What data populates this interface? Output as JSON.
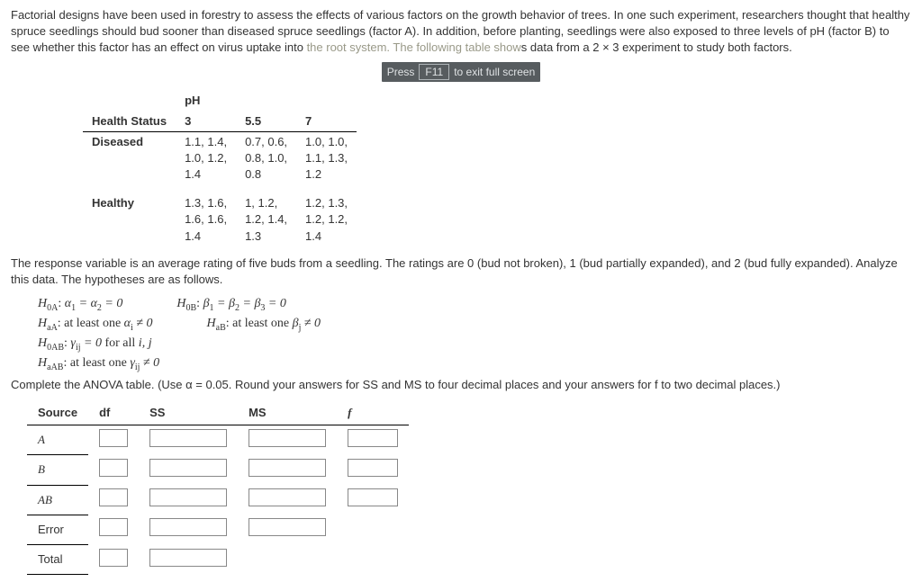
{
  "intro": {
    "p1a": "Factorial designs have been used in forestry to assess the effects of various factors on the growth behavior of trees. In one such experiment, researchers thought that healthy spruce seedlings should bud sooner than diseased spruce seedlings (factor A). In addition, before planting, seedlings were also exposed to three levels of pH (factor B) to see whether this factor has an effect on virus uptake into ",
    "dim1": "the root system. The following table show",
    "p1b": "s data from a 2 × 3 experiment to study both factors.",
    "hint_pre": "Press",
    "hint_key": "F11",
    "hint_post": "to exit full screen"
  },
  "table": {
    "ph_label": "pH",
    "hs_label": "Health Status",
    "ph_levels": [
      "3",
      "5.5",
      "7"
    ],
    "rows": [
      {
        "label": "Diseased",
        "cells": [
          "1.1, 1.4,\n1.0, 1.2,\n1.4",
          "0.7, 0.6,\n0.8, 1.0,\n0.8",
          "1.0, 1.0,\n1.1, 1.3,\n1.2"
        ]
      },
      {
        "label": "Healthy",
        "cells": [
          "1.3, 1.6,\n1.6, 1.6,\n1.4",
          "1, 1.2,\n1.2, 1.4,\n1.3",
          "1.2, 1.3,\n1.2, 1.2,\n1.4"
        ]
      }
    ]
  },
  "mid": {
    "p2": "The response variable is an average rating of five buds from a seedling. The ratings are 0 (bud not broken), 1 (bud partially expanded), and 2 (bud fully expanded). Analyze this data. The hypotheses are as follows."
  },
  "hyp": {
    "h0a": "H₀A: α₁ = α₂ = 0",
    "haa": "HaA: at least one αi ≠ 0",
    "h0b": "H₀B: β₁ = β₂ = β₃ = 0",
    "hab": "HaB: at least one βj ≠ 0",
    "h0ab": "H₀AB: γij = 0 for all i, j",
    "haab": "HaAB: at least one γij ≠ 0"
  },
  "instr": "Complete the ANOVA table. (Use α = 0.05. Round your answers for SS and MS to four decimal places and your answers for f to two decimal places.)",
  "anova": {
    "headers": [
      "Source",
      "df",
      "SS",
      "MS",
      "f"
    ],
    "rows": [
      "A",
      "B",
      "AB",
      "Error",
      "Total"
    ]
  }
}
